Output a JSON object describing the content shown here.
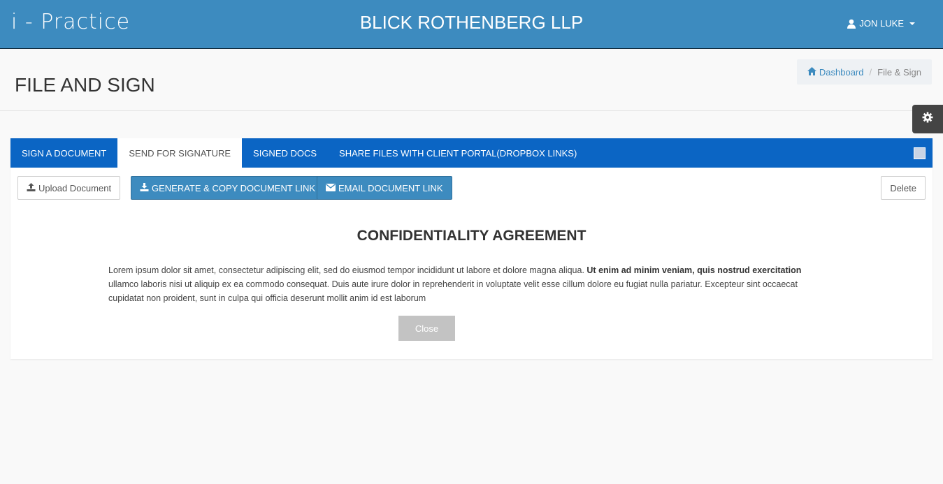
{
  "header": {
    "logo_text": "i - Practice",
    "firm_name": "BLICK ROTHENBERG LLP",
    "user_name": "JON LUKE",
    "user_icon": "user-icon",
    "bg_color": "#3d8bbf"
  },
  "page": {
    "title": "FILE AND SIGN",
    "breadcrumb": {
      "home_label": "Dashboard",
      "home_icon": "home-icon",
      "current": "File & Sign"
    }
  },
  "settings": {
    "icon": "gear-icon"
  },
  "tabs": [
    {
      "label": "SIGN A DOCUMENT",
      "active": false
    },
    {
      "label": "SEND FOR SIGNATURE",
      "active": true
    },
    {
      "label": "SIGNED DOCS",
      "active": false
    },
    {
      "label": "SHARE FILES WITH CLIENT PORTAL(DROPBOX LINKS)",
      "active": false
    }
  ],
  "tab_bar_color": "#0b65c4",
  "toolbar": {
    "upload_label": "Upload Document",
    "upload_icon": "upload-icon",
    "generate_label": "GENERATE & COPY DOCUMENT LINK",
    "generate_icon": "download-icon",
    "email_label": "EMAIL DOCUMENT LINK",
    "email_icon": "envelope-icon",
    "delete_label": "Delete"
  },
  "document": {
    "title": "CONFIDENTIALITY AGREEMENT",
    "text_1": "Lorem ipsum dolor sit amet, consectetur adipiscing elit, sed do eiusmod tempor incididunt ut labore et dolore magna aliqua. ",
    "text_bold": "Ut enim ad minim veniam, quis nostrud exercitation",
    "text_2": " ullamco laboris nisi ut aliquip ex ea commodo consequat. Duis aute irure dolor in reprehenderit in voluptate velit esse cillum dolore eu fugiat nulla pariatur. Excepteur sint occaecat cupidatat non proident, sunt in culpa qui officia deserunt mollit anim id est laborum",
    "close_label": "Close"
  }
}
